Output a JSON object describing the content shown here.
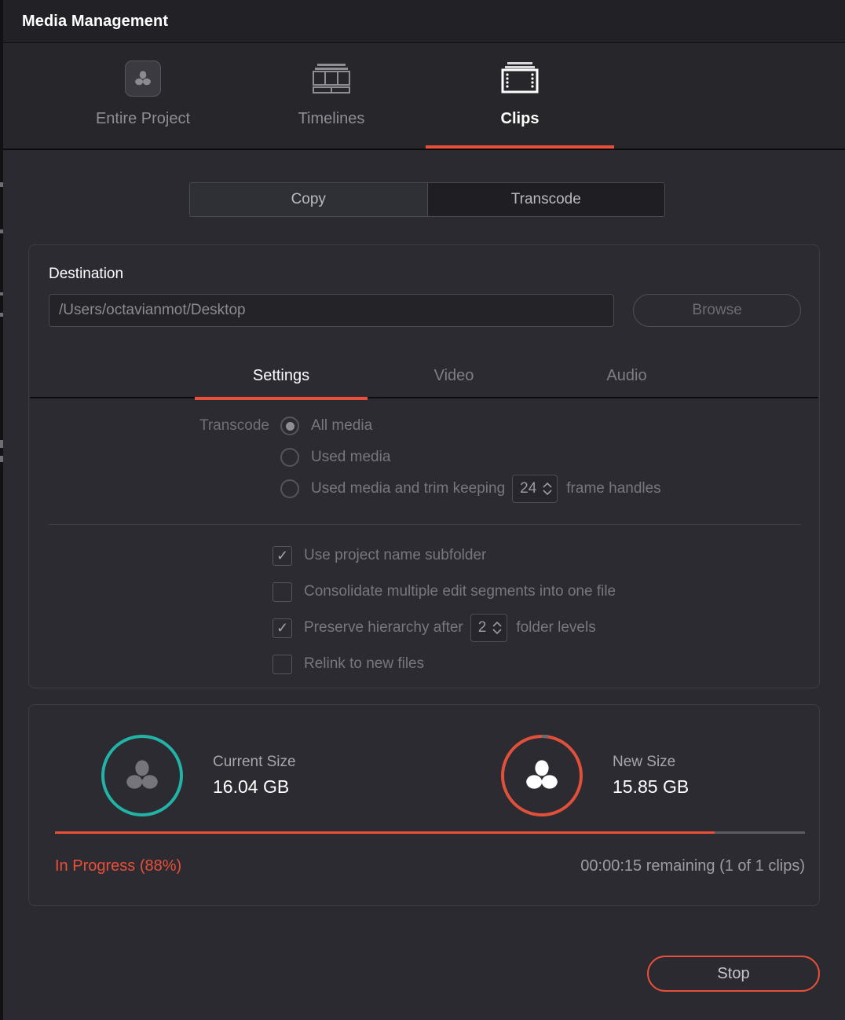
{
  "window": {
    "title": "Media Management"
  },
  "top_tabs": [
    {
      "label": "Entire Project",
      "icon": "resolve-logo-icon",
      "active": false
    },
    {
      "label": "Timelines",
      "icon": "timeline-icon",
      "active": false
    },
    {
      "label": "Clips",
      "icon": "film-strip-icon",
      "active": true
    }
  ],
  "mode_toggle": {
    "copy_label": "Copy",
    "transcode_label": "Transcode",
    "selected": "Transcode"
  },
  "settings_panel": {
    "title": "Destination",
    "destination_path": "/Users/octavianmot/Desktop",
    "destination_placeholder": "/Users/octavianmot/Desktop",
    "browse_label": "Browse",
    "subtabs": [
      {
        "label": "Settings",
        "active": true
      },
      {
        "label": "Video",
        "active": false
      },
      {
        "label": "Audio",
        "active": false
      }
    ],
    "transcode_group_label": "Transcode",
    "radios": [
      {
        "label": "All media",
        "selected": true
      },
      {
        "label": "Used media",
        "selected": false
      },
      {
        "label": "Used media and trim keeping",
        "selected": false,
        "suffix": "frame handles",
        "value": "24"
      }
    ],
    "checkboxes": [
      {
        "label": "Use project name subfolder",
        "checked": true
      },
      {
        "label": "Consolidate multiple edit segments into one file",
        "checked": false
      },
      {
        "label": "Preserve hierarchy after",
        "checked": true,
        "value": "2",
        "suffix": "folder levels"
      },
      {
        "label": "Relink to new files",
        "checked": false
      }
    ],
    "check_glyph": "✓"
  },
  "progress_panel": {
    "current": {
      "label": "Current Size",
      "value": "16.04 GB",
      "ring_color": "#22b2a6"
    },
    "new": {
      "label": "New Size",
      "value": "15.85 GB",
      "ring_color": "#e0503b"
    },
    "progress_percent": 88,
    "status_text": "In Progress (88%)",
    "remaining_text": "00:00:15 remaining (1 of 1 clips)",
    "progress_color": "#e8503a"
  },
  "footer": {
    "stop_label": "Stop"
  }
}
